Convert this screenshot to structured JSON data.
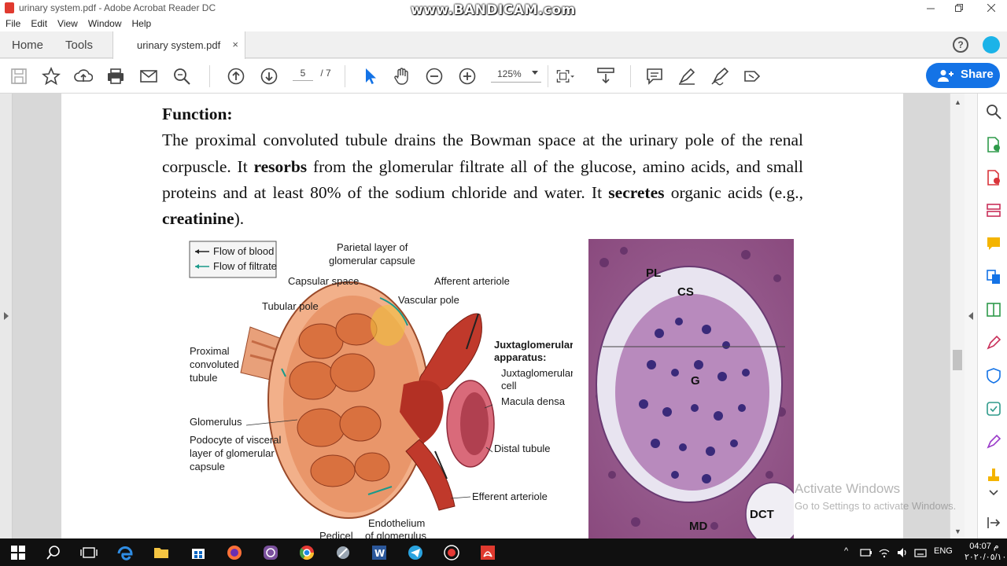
{
  "window": {
    "title": "urinary system.pdf - Adobe Acrobat Reader DC",
    "watermark": "www.BANDICAM.com",
    "controls": [
      "minimize",
      "restore",
      "close"
    ]
  },
  "menu": [
    "File",
    "Edit",
    "View",
    "Window",
    "Help"
  ],
  "tabs": {
    "home": "Home",
    "tools": "Tools",
    "document": "urinary system.pdf",
    "close": "×"
  },
  "toolbar": {
    "page_current": "5",
    "page_total": "/ 7",
    "zoom": "125%",
    "share_label": "Share",
    "icons": [
      "save-icon",
      "bookmark-star-icon",
      "upload-icon",
      "print-icon",
      "email-icon",
      "search-icon",
      "prev-page-icon",
      "next-page-icon",
      "select-cursor-icon",
      "hand-icon",
      "zoom-out-icon",
      "zoom-in-icon",
      "fit-page-icon",
      "scroll-mode-icon",
      "comment-icon",
      "highlight-pen-icon",
      "sign-icon",
      "fill-sign-icon"
    ]
  },
  "document": {
    "heading": "Function:",
    "p1": "The proximal convoluted tubule drains the Bowman space at the urinary pole of the renal corpuscle. It ",
    "p1_bold1": "resorbs",
    "p1_mid": " from the glomerular filtrate all of the glucose, amino acids, and small proteins and at least 80% of the sodium chloride and water. It ",
    "p1_bold2": "secretes",
    "p1_mid2": " organic acids (e.g., ",
    "p1_bold3": "creatinine",
    "p1_end": ")."
  },
  "figure": {
    "legend": [
      "Flow of blood",
      "Flow of filtrate"
    ],
    "labels": {
      "parietal1": "Parietal layer of",
      "parietal2": "glomerular capsule",
      "capsular_space": "Capsular space",
      "afferent": "Afferent arteriole",
      "tubular_pole": "Tubular pole",
      "vascular_pole": "Vascular pole",
      "proximal1": "Proximal",
      "proximal2": "convoluted",
      "proximal3": "tubule",
      "jga1": "Juxtaglomerular",
      "jga2": "apparatus:",
      "jgc1": "Juxtaglomerular",
      "jgc2": "cell",
      "macula": "Macula densa",
      "glomerulus": "Glomerulus",
      "podocyte1": "Podocyte of visceral",
      "podocyte2": "layer of glomerular",
      "podocyte3": "capsule",
      "distal": "Distal tubule",
      "efferent": "Efferent arteriole",
      "endothelium1": "Endothelium",
      "endothelium2": "of glomerulus",
      "pedicel": "Pedicel"
    },
    "micro_labels": [
      "PL",
      "CS",
      "G",
      "MD",
      "DCT"
    ]
  },
  "activation": {
    "line1": "Activate Windows",
    "line2": "Go to Settings to activate Windows."
  },
  "taskbar": {
    "lang": "ENG",
    "time": "04:07 م",
    "date": "٢٠٢٠/٠٥/١٠"
  },
  "colors": {
    "share_blue": "#1473e6",
    "acrobat_red": "#e03a2f",
    "taskbar": "#101010"
  }
}
